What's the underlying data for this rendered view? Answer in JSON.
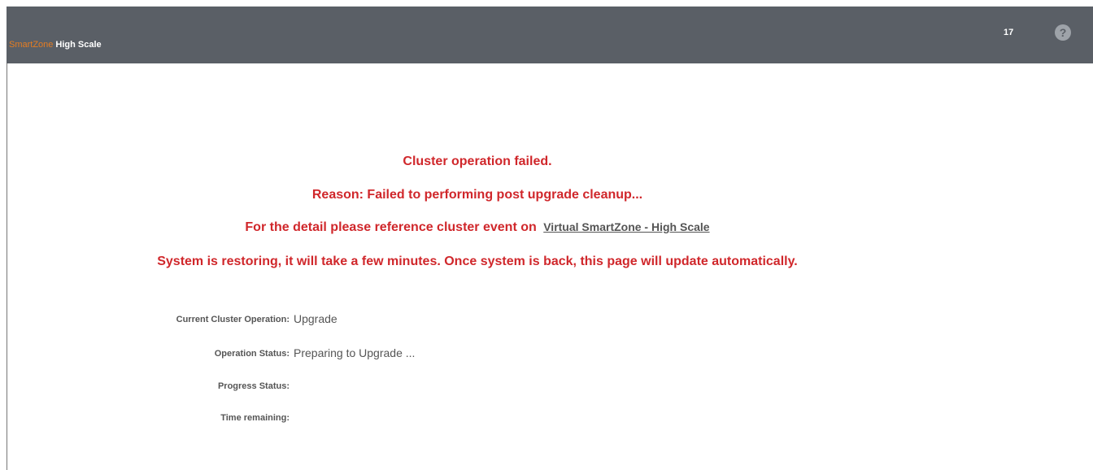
{
  "header": {
    "brand_name": "SmartZone",
    "brand_edition": "High Scale",
    "count": "17",
    "help_icon": "question-circle-icon",
    "help_label": "?"
  },
  "messages": {
    "line1": "Cluster operation failed.",
    "line2": "Reason: Failed to performing post upgrade cleanup...",
    "line3_prefix": "For the detail please reference cluster event on",
    "line3_link": "Virtual SmartZone - High Scale",
    "line4": "System is restoring, it will take a few minutes. Once system is back, this page will update automatically."
  },
  "status": {
    "current_operation_label": "Current Cluster Operation:",
    "current_operation_value": "Upgrade",
    "operation_status_label": "Operation Status:",
    "operation_status_value": "Preparing to Upgrade ...",
    "progress_status_label": "Progress Status:",
    "progress_status_value": "",
    "time_remaining_label": "Time remaining:",
    "time_remaining_value": ""
  },
  "colors": {
    "header_bg": "#5a5f66",
    "brand_accent": "#e57d22",
    "error_red": "#d0272b",
    "text_gray": "#555555"
  }
}
